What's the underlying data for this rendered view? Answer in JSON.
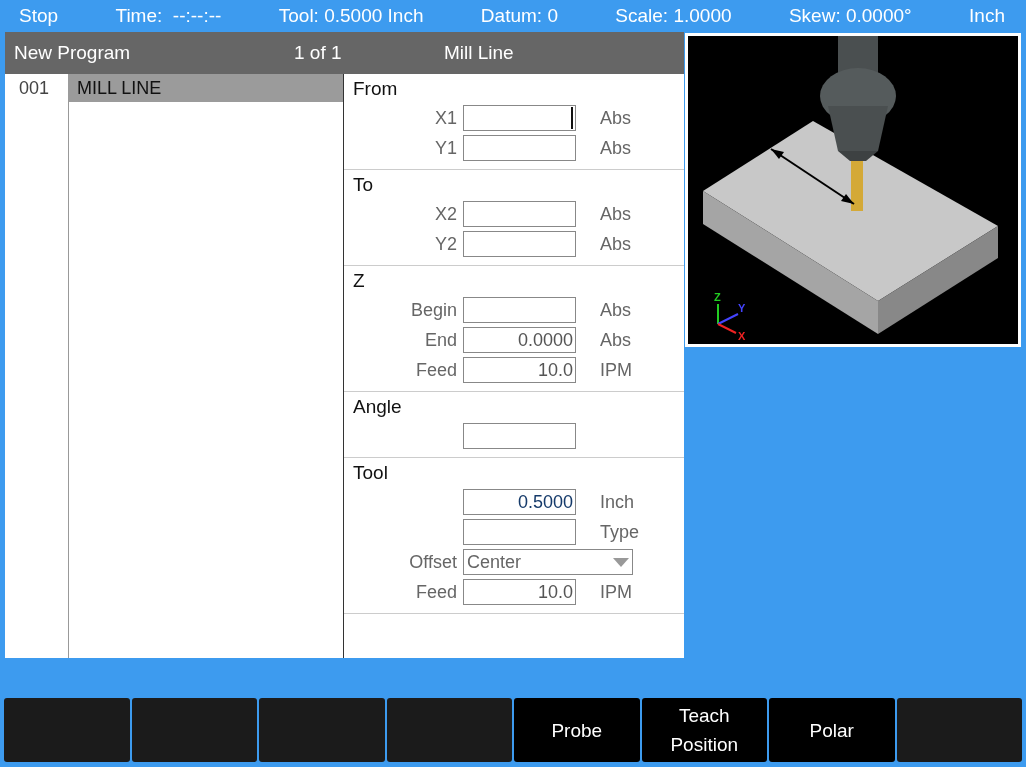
{
  "status_bar": {
    "items": [
      "Stop",
      "Time:  --:--:--",
      "Tool: 0.5000 Inch",
      "Datum: 0",
      "Scale: 1.0000",
      "Skew: 0.0000°",
      "Inch"
    ]
  },
  "header": {
    "title": "New Program",
    "page": "1 of 1",
    "step": "Mill Line"
  },
  "program_list": [
    {
      "number": "001",
      "name": "MILL LINE",
      "selected": true
    }
  ],
  "sections": [
    {
      "title": "From",
      "fields": [
        {
          "kind": "input",
          "label": "X1",
          "unit": "Abs",
          "focused": true
        },
        {
          "kind": "input",
          "label": "Y1",
          "unit": "Abs",
          "focused": false
        }
      ]
    },
    {
      "title": "To",
      "fields": [
        {
          "kind": "input",
          "label": "X2",
          "unit": "Abs",
          "focused": false
        },
        {
          "kind": "input",
          "label": "Y2",
          "unit": "Abs",
          "focused": false
        }
      ]
    },
    {
      "title": "Z",
      "fields": [
        {
          "kind": "input",
          "label": "Begin",
          "unit": "Abs",
          "focused": false
        },
        {
          "kind": "input",
          "label": "End",
          "value": "0.0000",
          "unit": "Abs",
          "focused": false,
          "highlight": false
        },
        {
          "kind": "input",
          "label": "Feed",
          "value": "10.0",
          "unit": "IPM",
          "focused": false,
          "highlight": false
        }
      ]
    },
    {
      "title": "Angle",
      "fields": [
        {
          "kind": "input",
          "focused": false
        }
      ]
    },
    {
      "title": "Tool",
      "fields": [
        {
          "kind": "input",
          "value": "0.5000",
          "unit": "Inch",
          "focused": false,
          "highlight": true
        },
        {
          "kind": "input",
          "unit": "Type",
          "focused": false
        },
        {
          "kind": "dropdown",
          "label": "Offset",
          "value": "Center"
        },
        {
          "kind": "input",
          "label": "Feed",
          "value": "10.0",
          "unit": "IPM",
          "focused": false,
          "highlight": false
        }
      ]
    }
  ],
  "preview": {
    "axes": [
      "Z",
      "Y",
      "X"
    ]
  },
  "softkeys": [
    {
      "kind": "blank"
    },
    {
      "kind": "blank"
    },
    {
      "kind": "blank"
    },
    {
      "kind": "blank"
    },
    {
      "kind": "labeled",
      "label": "Probe"
    },
    {
      "kind": "labeled",
      "label": "Teach Position"
    },
    {
      "kind": "labeled",
      "label": "Polar"
    },
    {
      "kind": "blank"
    }
  ]
}
